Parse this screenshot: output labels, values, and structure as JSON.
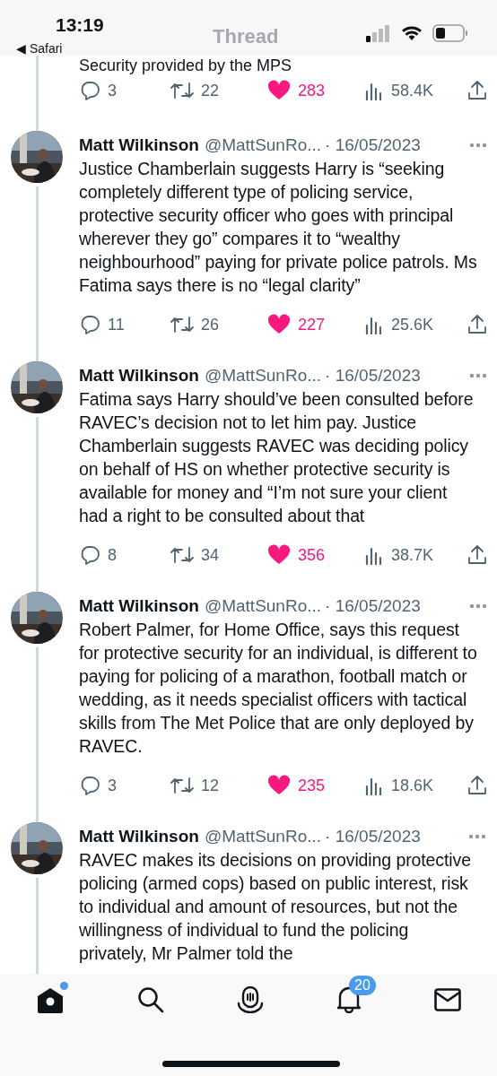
{
  "status_bar": {
    "time": "13:19",
    "back_app": "◀ Safari"
  },
  "header": {
    "title": "Thread"
  },
  "previous_tweet": {
    "text_tail": "Security provided by the MPS",
    "replies": "3",
    "retweets": "22",
    "likes": "283",
    "liked": true,
    "views": "58.4K"
  },
  "tweets": [
    {
      "name": "Matt Wilkinson",
      "handle": "@MattSunRo...",
      "date": "· 16/05/2023",
      "text": "Justice Chamberlain suggests Harry is “seeking completely different type of policing service, protective security officer who goes with principal wherever they go” compares it to “wealthy neighbourhood” paying for private police patrols. Ms Fatima says there is no “legal clarity”",
      "replies": "11",
      "retweets": "26",
      "likes": "227",
      "liked": true,
      "views": "25.6K"
    },
    {
      "name": "Matt Wilkinson",
      "handle": "@MattSunRo...",
      "date": "· 16/05/2023",
      "text": "Fatima says Harry should’ve been consulted before RAVEC’s decision not to let him pay. Justice Chamberlain suggests RAVEC was deciding policy on behalf of HS on whether protective security is available for money and “I’m not sure your client had a right to be consulted about that",
      "replies": "8",
      "retweets": "34",
      "likes": "356",
      "liked": true,
      "views": "38.7K"
    },
    {
      "name": "Matt Wilkinson",
      "handle": "@MattSunRo...",
      "date": "· 16/05/2023",
      "text": "Robert Palmer, for Home Office, says this request for protective security for an individual, is different to paying for policing of a marathon, football match or wedding, as it needs specialist officers with tactical skills from The Met Police that are only deployed by RAVEC.",
      "replies": "3",
      "retweets": "12",
      "likes": "235",
      "liked": true,
      "views": "18.6K"
    },
    {
      "name": "Matt Wilkinson",
      "handle": "@MattSunRo...",
      "date": "· 16/05/2023",
      "text": "RAVEC makes its decisions on providing protective policing (armed cops) based on public interest, risk to individual and amount of resources, but not the willingness of individual to fund the policing privately, Mr Palmer told the"
    }
  ],
  "tab_bar": [
    {
      "kind": "home",
      "selected": true,
      "dot": true
    },
    {
      "kind": "search",
      "selected": false
    },
    {
      "kind": "spaces",
      "selected": false
    },
    {
      "kind": "notifications",
      "selected": false,
      "badge": "20"
    },
    {
      "kind": "messages",
      "selected": false
    }
  ]
}
